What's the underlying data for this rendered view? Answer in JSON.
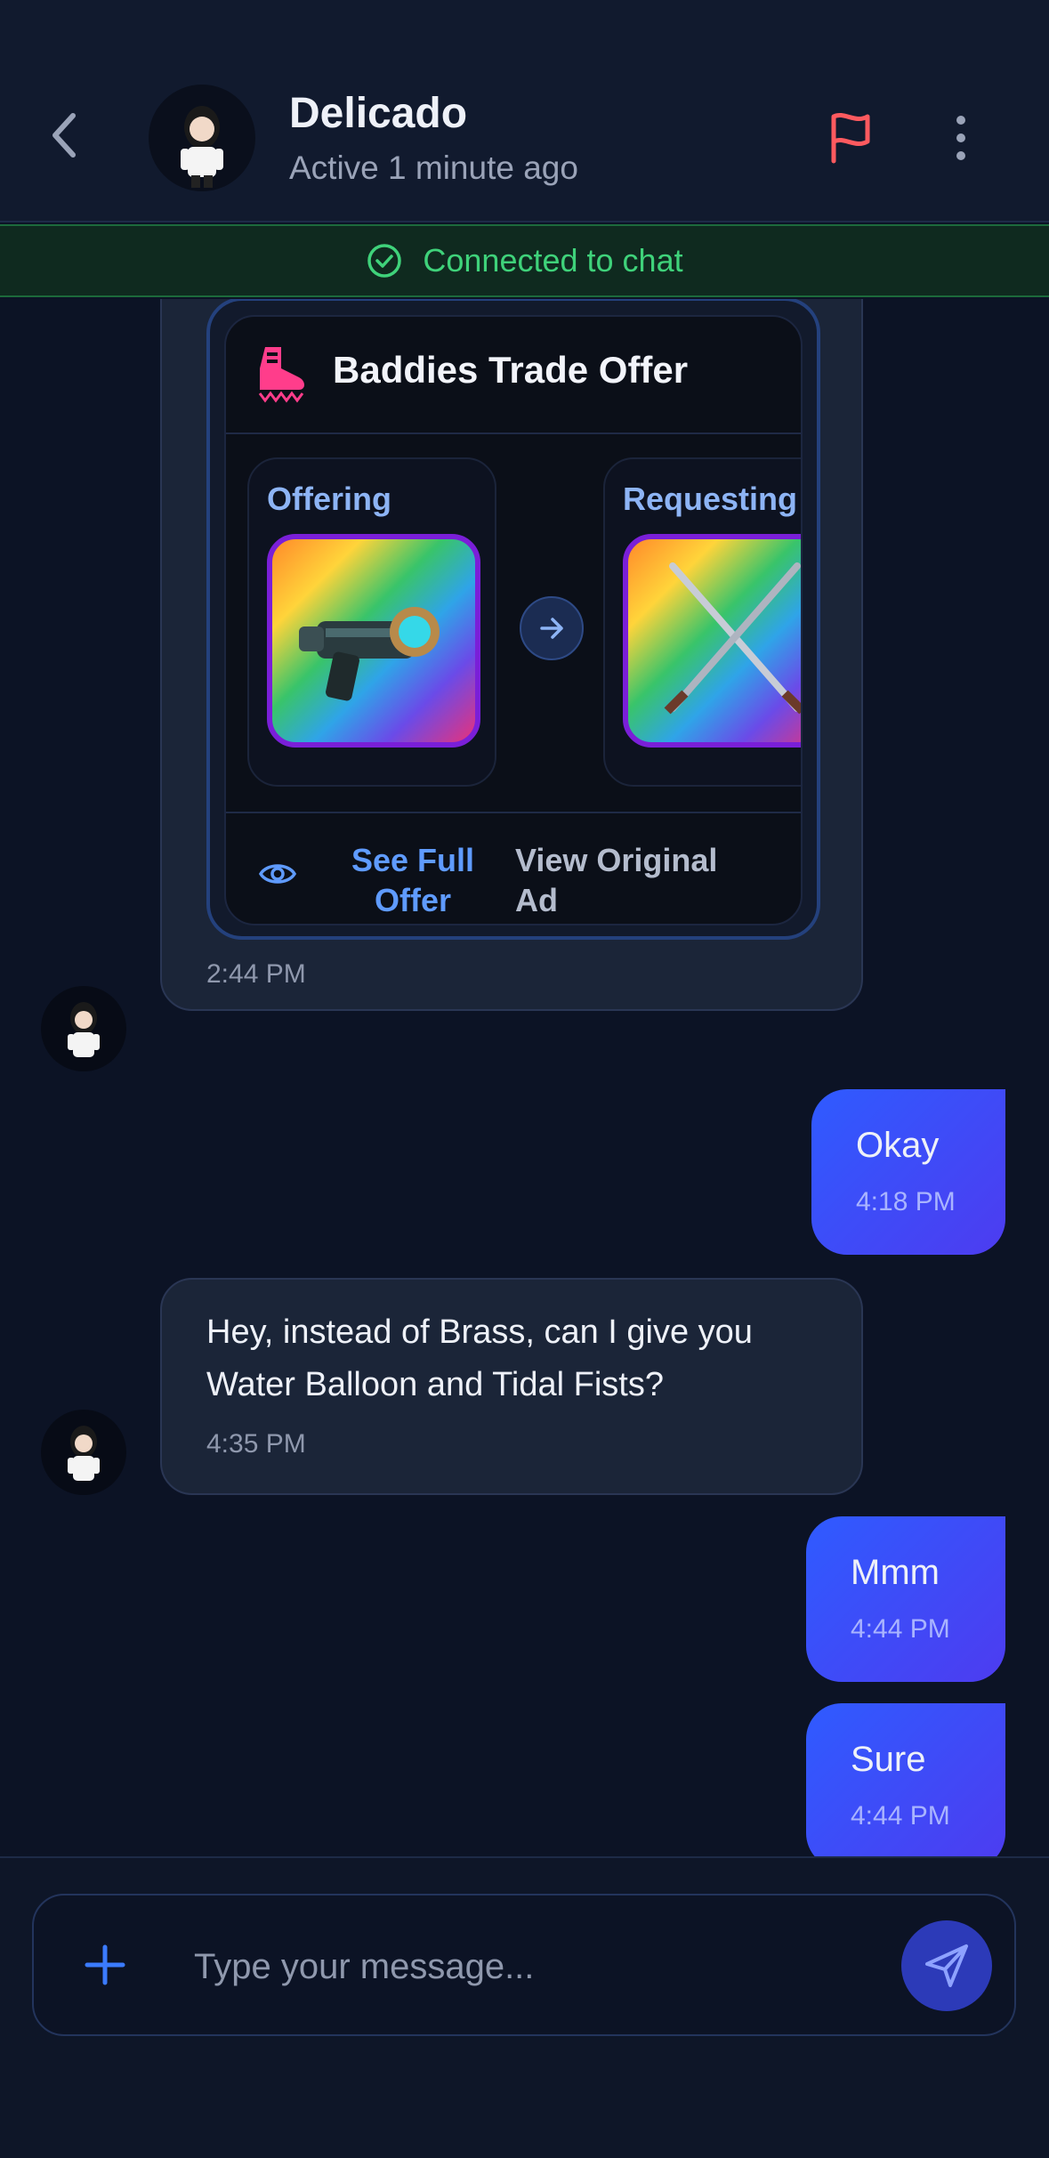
{
  "header": {
    "contact_name": "Delicado",
    "contact_status": "Active 1 minute ago"
  },
  "banner": {
    "text": "Connected to chat"
  },
  "messages": {
    "trade": {
      "title": "Baddies Trade Offer",
      "offering_label": "Offering",
      "requesting_label": "Requesting",
      "see_full_label": "See Full Offer",
      "view_original_label": "View Original Ad",
      "time": "2:44 PM"
    },
    "m1": {
      "text": "Okay",
      "time": "4:18 PM"
    },
    "m2": {
      "text": "Hey, instead of Brass, can I give you Water Balloon and Tidal Fists?",
      "time": "4:35 PM"
    },
    "m3": {
      "text": "Mmm",
      "time": "4:44 PM"
    },
    "m4": {
      "text": "Sure",
      "time": "4:44 PM"
    }
  },
  "composer": {
    "placeholder": "Type your message..."
  },
  "colors": {
    "background": "#0c1325",
    "accent": "#2f5bff",
    "banner_green": "#3fd27a",
    "flag_red": "#ff5a5f",
    "link_blue": "#5f9bff"
  },
  "icons": [
    "chevron-left-icon",
    "flag-icon",
    "more-vertical-icon",
    "check-circle-icon",
    "boot-logo-icon",
    "arrow-right-icon",
    "eye-icon",
    "plus-icon",
    "send-icon"
  ]
}
